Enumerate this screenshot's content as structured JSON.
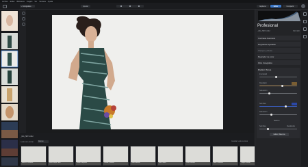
{
  "menu": {
    "items": [
      "Archivo",
      "Editar",
      "Biblioteca",
      "Imagen",
      "Ver",
      "Ventana",
      "Ayuda"
    ]
  },
  "toolbar": {
    "back_label": "Fotografías",
    "zoom_label": "Ajustar",
    "explore_label": "Explorar",
    "edit_label": "Editar",
    "share_label": "Compartir"
  },
  "right_panel": {
    "profile": "Profesional",
    "filename": "_MG_5871.CR2",
    "iso": "ISO 100",
    "tools": [
      {
        "label": "Contraste Avanzado",
        "dim": false
      },
      {
        "label": "Degradado Ajustable",
        "dim": false
      },
      {
        "label": "Sharpen y Ruido",
        "dim": true
      },
      {
        "label": "Mejorador de color",
        "dim": false
      },
      {
        "label": "Filtro Fotográfico",
        "dim": false
      }
    ],
    "gradient_tool": {
      "title": "División Tonos",
      "sliders": [
        {
          "label": "Intensidad",
          "value": 0.45,
          "track": "#66696e",
          "swatch": ""
        },
        {
          "label": "Resaltado",
          "value": 0.62,
          "track": "#b79561",
          "swatch": "#7a5e33"
        },
        {
          "label": "Saturación",
          "value": 0.25,
          "track": "#66696e",
          "swatch": ""
        },
        {
          "label": "Sombras",
          "value": 0.72,
          "track": "#3a5bb8",
          "swatch": "#2a47a7"
        },
        {
          "label": "Saturación",
          "value": 0.3,
          "track": "#66696e",
          "swatch": ""
        }
      ],
      "balance_label": "Balance",
      "balance_left": "Sombras",
      "balance_right": "Resaltados",
      "balance_value": 0.22,
      "edit_mask_label": "Editar Máscara"
    }
  },
  "bottom": {
    "file_label": "_MG_5871.CR2",
    "presets_label": "Looks de Luminar",
    "filter_label": "Retrato",
    "right_label": "Guardar Looks Luminar"
  },
  "presets": [
    "Blanco Profundo",
    "B&W Sepia Tono",
    "Warm Elegante",
    "Cálido y Suave",
    "Tono Retrato",
    "Skin Tones",
    "Cool Fashion",
    "Alto Contraste",
    "Toque Dorado",
    "Película Clásica"
  ],
  "colors": {
    "accent": "#3a77c8",
    "background": "#202124",
    "panel": "#232427"
  }
}
